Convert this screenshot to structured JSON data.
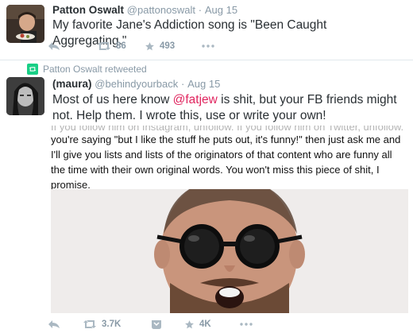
{
  "tweet1": {
    "fullname": "Patton Oswalt",
    "handle": "@pattonoswalt",
    "separator": "·",
    "date": "Aug 15",
    "text": "My favorite Jane's Addiction song is \"Been Caught Aggregating.\"",
    "retweets": "86",
    "likes": "493"
  },
  "retweet_label": "Patton Oswalt retweeted",
  "tweet2": {
    "fullname": "(maura)",
    "handle": "@behindyourback",
    "separator": "·",
    "date": "Aug 15",
    "text_before": "Most of us here know ",
    "mention": "@fatjew",
    "text_after": " is shit, but your FB friends might not. Help them. I wrote this, use or write your own!",
    "note_cut_line": "If you follow him on Instagram, unfollow. If you follow him on Twitter, unfollow.",
    "note_text": "you're saying \"but I like the stuff he puts out, it's funny!\" then just ask me and I'll give you lists and lists of the originators of that content who are funny all the time with their own original words. You won't miss this piece of shit, I promise.",
    "retweets": "3.7K",
    "likes": "4K"
  },
  "colors": {
    "accent_mention": "#e0245e",
    "meta_gray": "#8899a6",
    "retweet_green": "#19cf86",
    "divider": "#e1e8ed"
  },
  "icons": [
    "reply-icon",
    "retweet-icon",
    "like-icon",
    "more-icon",
    "dm-icon"
  ]
}
